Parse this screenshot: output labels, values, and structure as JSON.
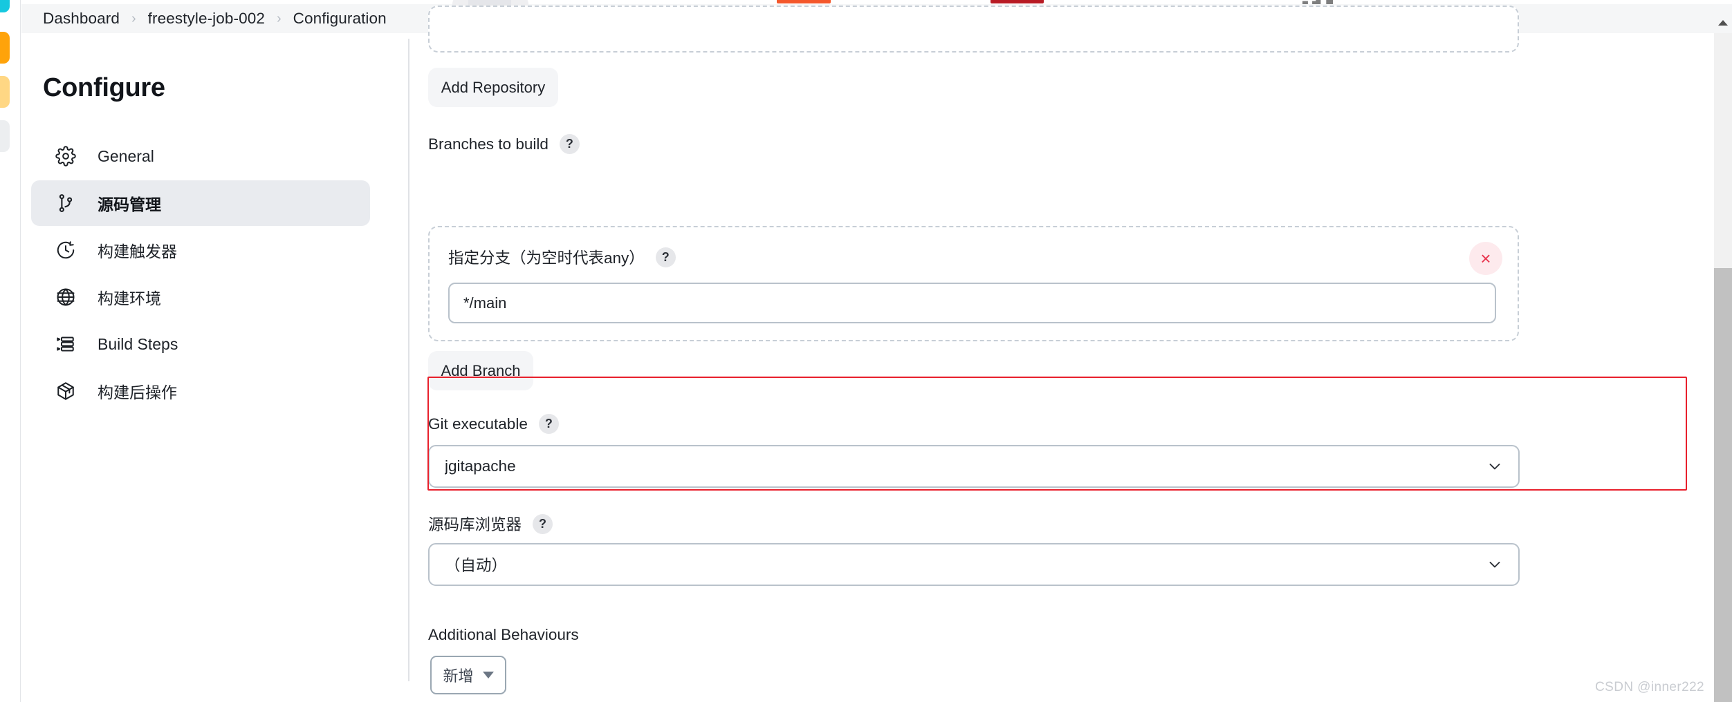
{
  "window": {
    "watermark": "CSDN @inner222"
  },
  "breadcrumb": {
    "items": [
      {
        "label": "Dashboard"
      },
      {
        "label": "freestyle-job-002"
      },
      {
        "label": "Configuration"
      }
    ],
    "separator": "›"
  },
  "sidebar": {
    "title": "Configure",
    "items": [
      {
        "label": "General",
        "icon": "gear-icon",
        "active": false
      },
      {
        "label": "源码管理",
        "icon": "git-branch-icon",
        "active": true
      },
      {
        "label": "构建触发器",
        "icon": "clock-icon",
        "active": false
      },
      {
        "label": "构建环境",
        "icon": "globe-icon",
        "active": false
      },
      {
        "label": "Build Steps",
        "icon": "list-steps-icon",
        "active": false
      },
      {
        "label": "构建后操作",
        "icon": "package-icon",
        "active": false
      }
    ]
  },
  "main": {
    "add_repository_button": "Add Repository",
    "branches_section": {
      "label": "Branches to build",
      "help": "?",
      "branch_spec": {
        "label": "指定分支（为空时代表any）",
        "help": "?",
        "value": "*/main",
        "remove_label": "×"
      }
    },
    "add_branch_button": "Add Branch",
    "git_executable": {
      "label": "Git executable",
      "help": "?",
      "value": "jgitapache",
      "highlight_color": "#e8202c"
    },
    "repo_browser": {
      "label": "源码库浏览器",
      "help": "?",
      "value": "（自动）"
    },
    "additional_behaviours": {
      "label": "Additional Behaviours",
      "add_button": "新增"
    }
  }
}
